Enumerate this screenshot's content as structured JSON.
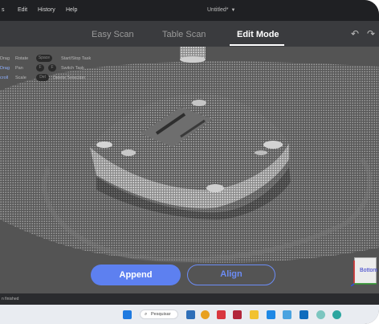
{
  "menu": {
    "items": [
      "s",
      "Edit",
      "History",
      "Help"
    ],
    "title": "Untitled*",
    "title_chevron": "▼"
  },
  "tabs": [
    {
      "label": "Easy Scan",
      "active": false
    },
    {
      "label": "Table Scan",
      "active": false
    },
    {
      "label": "Edit Mode",
      "active": true
    }
  ],
  "toolbar": {
    "undo_glyph": "↶",
    "redo_glyph": "↷"
  },
  "help": [
    {
      "key1": "Drag",
      "key2": "Rotate",
      "keys": [
        "Space"
      ],
      "desc": "Start/Stop Task"
    },
    {
      "key1": "Drag",
      "key2": "Pan",
      "keys": [
        "F",
        "F"
      ],
      "desc": "Switch Task"
    },
    {
      "key1": "croll",
      "key2": "Scale",
      "keys": [
        "Del"
      ],
      "desc": "Delete Selection"
    }
  ],
  "actions": {
    "append": "Append",
    "align": "Align"
  },
  "view_cube": {
    "label": "Bottom"
  },
  "status": {
    "text": "n finished"
  },
  "taskbar": {
    "search_placeholder": "Pesquisar"
  },
  "colors": {
    "accent": "#5d80f0",
    "menu_bg": "#1f2023",
    "tab_bg": "#3a3b3e",
    "viewport_bg": "#545454"
  }
}
